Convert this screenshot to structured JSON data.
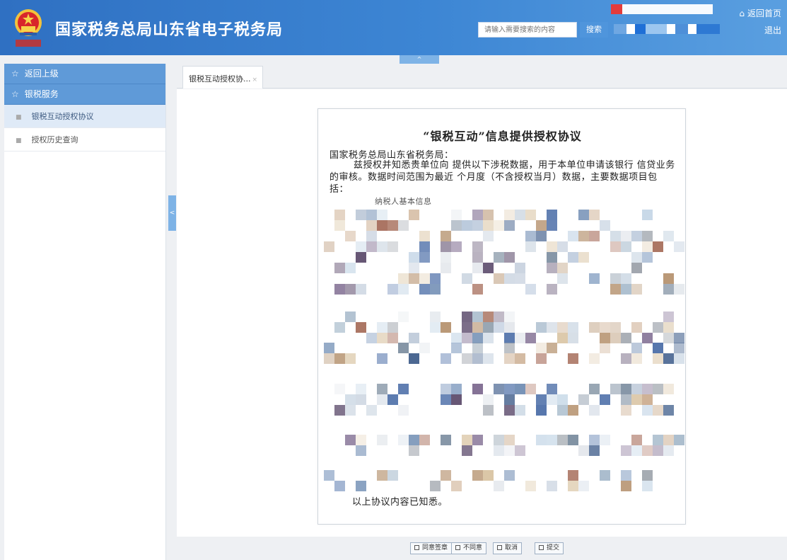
{
  "header": {
    "site_title": "国家税务总局山东省电子税务局",
    "search_placeholder": "请输入需要搜索的内容",
    "search_button": "搜索",
    "home_link": "返回首页",
    "logout_link": "退出",
    "collapse_glyph": "^"
  },
  "sidebar": {
    "back_label": "返回上级",
    "section_label": "银税服务",
    "items": [
      {
        "label": "银税互动授权协议"
      },
      {
        "label": "授权历史查询"
      }
    ],
    "toggle_glyph": "<"
  },
  "tabs": [
    {
      "label": "银税互动授权协...",
      "close": "×"
    }
  ],
  "document": {
    "title": "“银税互动”信息提供授权协议",
    "addressee": "国家税务总局山东省税务局：",
    "para1": "兹授权并知悉贵单位向      提供以下涉税数据，用于本单位申请该银行  信贷业务的审核。数据时间范围为最近  个月度（不含授权当月）数据，主要数据项目包括：",
    "partial_item": "纳税人基本信息",
    "closing": "以上协议内容已知悉。"
  },
  "buttons": [
    {
      "label": "同意签章"
    },
    {
      "label": "不同意"
    },
    {
      "label": "取消"
    },
    {
      "label": "提交"
    }
  ],
  "icons": {
    "emblem": "tax-emblem-icon",
    "home": "home-icon",
    "star": "star-icon",
    "bullet": "square-bullet-icon",
    "checkbox": "checkbox-icon"
  },
  "colors": {
    "header_gradient_start": "#2f70c2",
    "header_gradient_end": "#5a9fe0",
    "sidebar_header": "#5f9ad8",
    "sidebar_active": "#dfeaf7"
  }
}
